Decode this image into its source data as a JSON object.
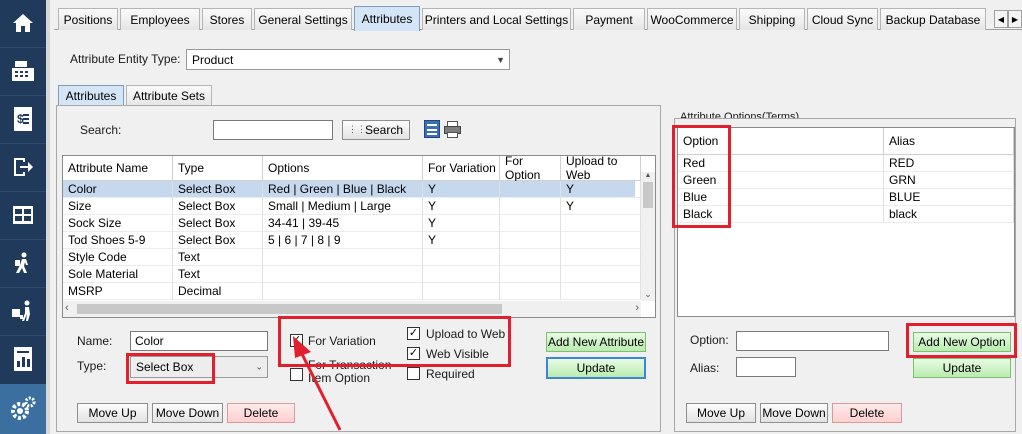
{
  "sidebar": {
    "icons": [
      "home-icon",
      "cash-register-icon",
      "receipt-icon",
      "logout-icon",
      "warehouse-icon",
      "delivery-icon",
      "hand-truck-icon",
      "report-icon",
      "settings-icon"
    ]
  },
  "top_tabs": [
    "Positions",
    "Employees",
    "Stores",
    "General Settings",
    "Attributes",
    "Printers and Local Settings",
    "Payment",
    "WooCommerce",
    "Shipping",
    "Cloud Sync",
    "Backup Database"
  ],
  "entity": {
    "label": "Attribute Entity Type:",
    "value": "Product"
  },
  "sub_tabs": [
    "Attributes",
    "Attribute Sets"
  ],
  "search": {
    "label": "Search:",
    "value": "",
    "button": "Search"
  },
  "grid": {
    "columns": [
      "Attribute Name",
      "Type",
      "Options",
      "For Variation",
      "For Option",
      "Upload to Web"
    ],
    "rows": [
      [
        "Color",
        "Select Box",
        "Red | Green | Blue | Black",
        "Y",
        "",
        "Y"
      ],
      [
        "Size",
        "Select Box",
        "Small | Medium | Large",
        "Y",
        "",
        "Y"
      ],
      [
        "Sock Size",
        "Select Box",
        "34-41 | 39-45",
        "Y",
        "",
        ""
      ],
      [
        "Tod Shoes 5-9",
        "Select Box",
        "5 | 6 | 7 | 8 | 9",
        "Y",
        "",
        ""
      ],
      [
        "Style Code",
        "Text",
        "",
        "",
        "",
        ""
      ],
      [
        "Sole Material",
        "Text",
        "",
        "",
        "",
        ""
      ],
      [
        "MSRP",
        "Decimal",
        "",
        "",
        "",
        ""
      ]
    ],
    "selected_row": 0
  },
  "form": {
    "name_label": "Name:",
    "name_value": "Color",
    "type_label": "Type:",
    "type_value": "Select Box",
    "for_variation": "For Variation",
    "for_transaction_line1": "For Transaction",
    "for_transaction_line2": "Item Option",
    "upload_to_web": "Upload to Web",
    "web_visible": "Web Visible",
    "required": "Required",
    "add_new_attribute": "Add New Attribute",
    "update": "Update",
    "move_up": "Move Up",
    "move_down": "Move Down",
    "delete": "Delete"
  },
  "options_panel": {
    "title": "Attribute Options(Terms)",
    "columns": [
      "Option",
      "Alias"
    ],
    "rows": [
      [
        "Red",
        "RED"
      ],
      [
        "Green",
        "GRN"
      ],
      [
        "Blue",
        "BLUE"
      ],
      [
        "Black",
        "black"
      ]
    ],
    "option_label": "Option:",
    "alias_label": "Alias:",
    "option_value": "",
    "alias_value": "",
    "add_new_option": "Add New Option",
    "update": "Update",
    "move_up": "Move Up",
    "move_down": "Move Down",
    "delete": "Delete"
  },
  "colors": {
    "sidebar": "#1f3a5a",
    "highlight": "#e0202c",
    "selected_row": "#c5d8ee",
    "green_button": "#b9ecae"
  }
}
